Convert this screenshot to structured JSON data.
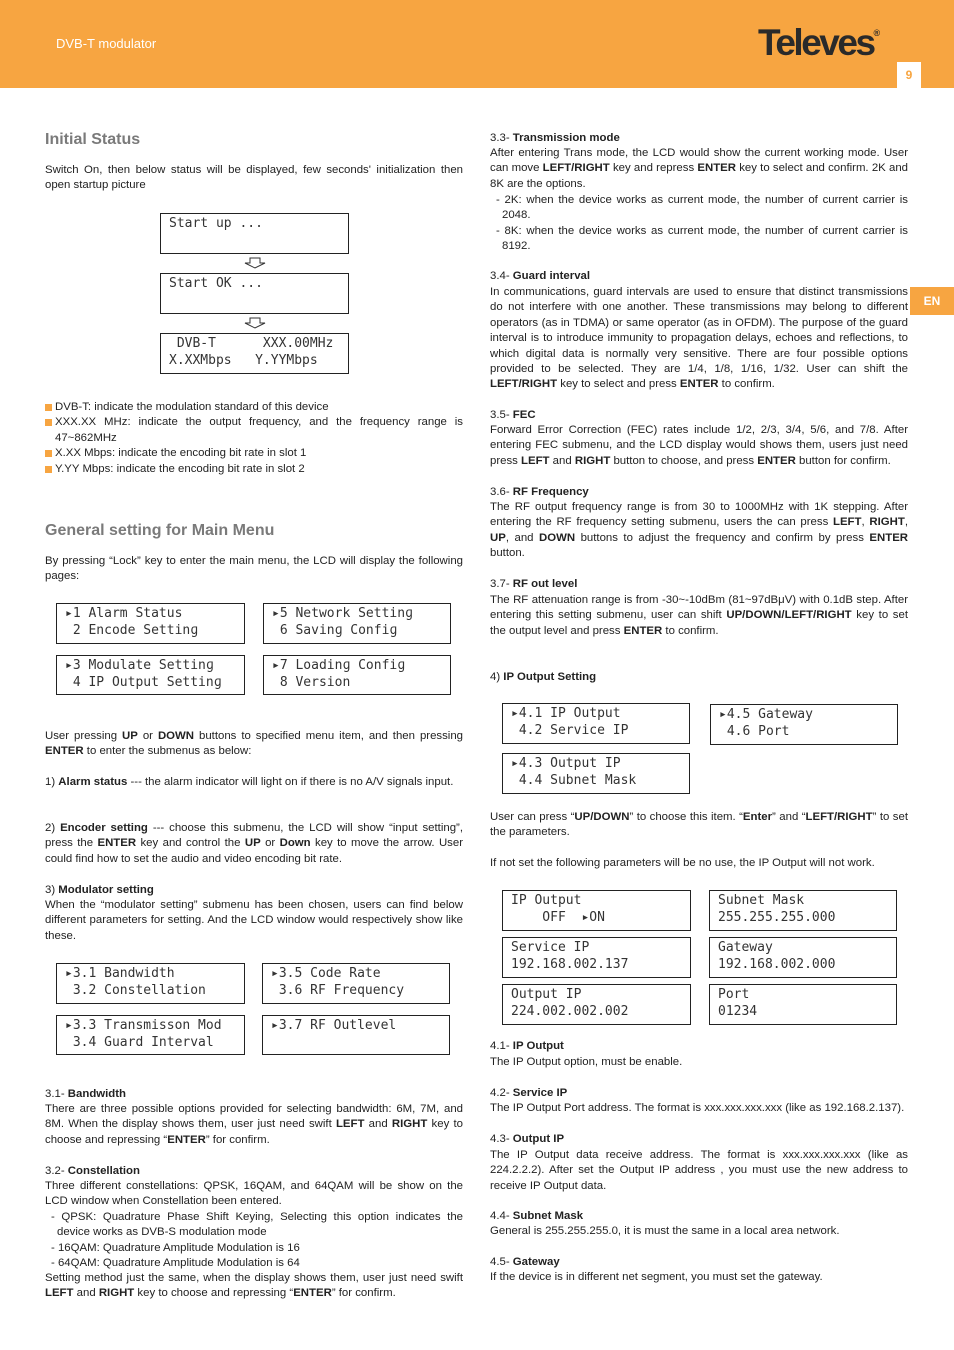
{
  "header": {
    "title": "DVB-T modulator",
    "logo": "Televes",
    "page": "9",
    "lang_tab": "EN",
    "accent": "#f7a541"
  },
  "initial": {
    "title": "Initial Status",
    "intro": "Switch On, then below status will be displayed, few seconds' initialization then open startup picture",
    "lcd": [
      [
        "Start up ...",
        ""
      ],
      [
        "Start OK ...",
        ""
      ],
      [
        " DVB-T      XXX.00MHz",
        "X.XXMbps   Y.YYMbps"
      ]
    ],
    "bullets": [
      "DVB-T: indicate the modulation standard of this device",
      "XXX.XX MHz: indicate the output frequency, and the frequency range is 47~862MHz",
      "X.XX Mbps: indicate the encoding bit rate in slot 1",
      "Y.YY Mbps: indicate the encoding bit rate in slot 2"
    ]
  },
  "general": {
    "title": "General setting for Main Menu",
    "intro": "By pressing “Lock” key to enter the main menu, the LCD will display the following pages:",
    "lcd": [
      [
        "▸1 Alarm Status",
        " 2 Encode Settinɡ"
      ],
      [
        "▸5 Network Settinɡ",
        " 6 Savinɡ Confiɡ"
      ],
      [
        "▸3 Modulate Settinɡ",
        " 4 IP Output Settinɡ"
      ],
      [
        "▸7 Loadinɡ Confiɡ",
        " 8 Version"
      ]
    ],
    "p1": [
      [
        "User pressing "
      ],
      [
        "UP",
        1
      ],
      [
        " or "
      ],
      [
        "DOWN",
        1
      ],
      [
        " buttons to specified menu item, and then pressing "
      ],
      [
        "ENTER",
        1
      ],
      [
        " to enter the submenus as below:"
      ]
    ],
    "p2": [
      [
        "1) "
      ],
      [
        "Alarm status",
        1
      ],
      [
        " --- the alarm indicator will light on if there is no A/V signals input."
      ]
    ],
    "p3": [
      [
        "2) "
      ],
      [
        "Encoder setting",
        1
      ],
      [
        " --- choose this submenu, the LCD will show “input setting”, press the "
      ],
      [
        "ENTER",
        1
      ],
      [
        " key and control the "
      ],
      [
        "UP",
        1
      ],
      [
        " or "
      ],
      [
        "Down",
        1
      ],
      [
        " key to move the arrow. User could find how to set the audio and video encoding bit rate."
      ]
    ],
    "p4a": [
      [
        "3) "
      ],
      [
        "Modulator setting",
        1
      ]
    ],
    "p4": [
      [
        "When the “modulator setting” submenu has been chosen, users can find below different parameters for setting. And the LCD window would respectively show like these."
      ]
    ],
    "lcd2": [
      [
        "▸3.1 Bandwidth",
        " 3.2 Constellation"
      ],
      [
        "▸3.5 Code Rate",
        " 3.6 RF Frequency"
      ],
      [
        "▸3.3 Transmisson Mod",
        " 3.4 Guard Interval"
      ],
      [
        "▸3.7 RF Outlevel",
        ""
      ]
    ],
    "s31h": [
      [
        "3.1- "
      ],
      [
        "Bandwidth",
        1
      ]
    ],
    "s31": [
      [
        "There are three possible options provided for selecting bandwidth: 6M, 7M, and 8M. When the display shows them, user just need swift "
      ],
      [
        "LEFT",
        1
      ],
      [
        " and "
      ],
      [
        "RIGHT",
        1
      ],
      [
        " key to choose and repressing “"
      ],
      [
        "ENTER",
        1
      ],
      [
        "” for confirm."
      ]
    ],
    "s32h": [
      [
        "3.2- "
      ],
      [
        "Constellation",
        1
      ]
    ],
    "s32": [
      [
        "Three different constellations: QPSK, 16QAM, and 64QAM will be show on the LCD window when Constellation been entered."
      ]
    ],
    "s32l": [
      "- QPSK: Quadrature Phase Shift Keying, Selecting this option indicates the device works as DVB-S modulation mode",
      "- 16QAM: Quadrature Amplitude Modulation is 16",
      "- 64QAM: Quadrature Amplitude Modulation is 64"
    ],
    "s32e": [
      [
        "Setting method just the same, when the display shows them, user just need swift "
      ],
      [
        "LEFT",
        1
      ],
      [
        " and "
      ],
      [
        "RIGHT",
        1
      ],
      [
        " key to choose and repressing “"
      ],
      [
        "ENTER",
        1
      ],
      [
        "” for confirm."
      ]
    ]
  },
  "right": {
    "s33h": [
      [
        "3.3- "
      ],
      [
        "Transmission mode",
        1
      ]
    ],
    "s33": [
      [
        "After entering Trans mode, the LCD would show the current working mode. User can move "
      ],
      [
        "LEFT/RIGHT",
        1
      ],
      [
        " key and repress "
      ],
      [
        "ENTER",
        1
      ],
      [
        " key to select and confirm. 2K and 8K are the options."
      ]
    ],
    "s33l": [
      "- 2K: when the device works as current mode, the number of current carrier is 2048.",
      "- 8K: when the device works as current mode, the number of current carrier is 8192."
    ],
    "s34h": [
      [
        "3.4- "
      ],
      [
        "Guard interval",
        1
      ]
    ],
    "s34": [
      [
        "In communications, guard intervals are used to ensure that distinct transmissions do not interfere with one another. These transmissions may belong to different operators (as in TDMA) or same operator (as in OFDM). The purpose of the guard interval is to introduce immunity to propagation delays, echoes and reflections, to which digital data is normally very sensitive. There are four possible options provided to be selected. They are 1/4, 1/8, 1/16, 1/32. User can shift the "
      ],
      [
        "LEFT/RIGHT",
        1
      ],
      [
        " key to select and press "
      ],
      [
        "ENTER",
        1
      ],
      [
        " to confirm."
      ]
    ],
    "s35h": [
      [
        "3.5- "
      ],
      [
        "FEC",
        1
      ]
    ],
    "s35": [
      [
        "Forward Error Correction (FEC) rates include 1/2, 2/3, 3/4, 5/6, and 7/8. After entering FEC submenu, and the LCD display would shows them, users just need press "
      ],
      [
        "LEFT",
        1
      ],
      [
        " and "
      ],
      [
        "RIGHT",
        1
      ],
      [
        " button to choose, and press "
      ],
      [
        "ENTER",
        1
      ],
      [
        " button for confirm."
      ]
    ],
    "s36h": [
      [
        "3.6- "
      ],
      [
        "RF Frequency",
        1
      ]
    ],
    "s36": [
      [
        "The RF output frequency range is from 30 to 1000MHz with 1K stepping. After entering the RF frequency setting submenu, users the can press "
      ],
      [
        "LEFT",
        1
      ],
      [
        ", "
      ],
      [
        "RIGHT",
        1
      ],
      [
        ", "
      ],
      [
        "UP",
        1
      ],
      [
        ", and "
      ],
      [
        "DOWN",
        1
      ],
      [
        " buttons to adjust the frequency and confirm by press "
      ],
      [
        "ENTER",
        1
      ],
      [
        " button."
      ]
    ],
    "s37h": [
      [
        "3.7- "
      ],
      [
        "RF out level",
        1
      ]
    ],
    "s37": [
      [
        "The RF attenuation range is from -30~-10dBm (81~97dBμV) with 0.1dB step. After entering this setting submenu, user can shift "
      ],
      [
        "UP/DOWN/LEFT/RIGHT",
        1
      ],
      [
        " key to set the output level and press "
      ],
      [
        "ENTER",
        1
      ],
      [
        " to confirm."
      ]
    ],
    "s4h": [
      [
        "4) "
      ],
      [
        "IP Output Setting",
        1
      ]
    ],
    "lcd": [
      [
        "▸4.1 IP Output",
        " 4.2 Service IP"
      ],
      [
        "▸4.5 Gateway",
        " 4.6 Port"
      ],
      [
        "▸4.3 Output IP",
        " 4.4 Subnet Mask"
      ]
    ],
    "p1": [
      [
        "User can press “"
      ],
      [
        "UP/DOWN",
        1
      ],
      [
        "” to choose this item. “"
      ],
      [
        "Enter",
        1
      ],
      [
        "” and “"
      ],
      [
        "LEFT/RIGHT",
        1
      ],
      [
        "” to set the parameters."
      ]
    ],
    "p2": [
      [
        "If not set the following parameters will be no use, the IP Output will not work."
      ]
    ],
    "lcd2": [
      [
        "IP Output",
        "    OFF  ▸ON"
      ],
      [
        "Subnet Mask",
        "255.255.255.000"
      ],
      [
        "Service IP",
        "192.168.002.137"
      ],
      [
        "Gateway",
        "192.168.002.000"
      ],
      [
        "Output IP",
        "224.002.002.002"
      ],
      [
        "Port",
        "01234"
      ]
    ],
    "s41h": [
      [
        "4.1- "
      ],
      [
        "IP Output",
        1
      ]
    ],
    "s41": [
      [
        "The IP Output option, must be enable."
      ]
    ],
    "s42h": [
      [
        "4.2- "
      ],
      [
        "Service IP",
        1
      ]
    ],
    "s42": [
      [
        "The IP Output Port address. The format is xxx.xxx.xxx.xxx (like as 192.168.2.137)."
      ]
    ],
    "s43h": [
      [
        "4.3- "
      ],
      [
        "Output IP",
        1
      ]
    ],
    "s43": [
      [
        "The IP Output data receive address. The format is xxx.xxx.xxx.xxx (like as 224.2.2.2). After set the Output IP address , you must use the new address to receive IP Output data."
      ]
    ],
    "s44h": [
      [
        "4.4- "
      ],
      [
        "Subnet Mask",
        1
      ]
    ],
    "s44": [
      [
        "General is 255.255.255.0, it is must the same in a local area network."
      ]
    ],
    "s45h": [
      [
        "4.5- "
      ],
      [
        "Gateway",
        1
      ]
    ],
    "s45": [
      [
        "If the device is in different net segment, you must set the gateway."
      ]
    ]
  }
}
